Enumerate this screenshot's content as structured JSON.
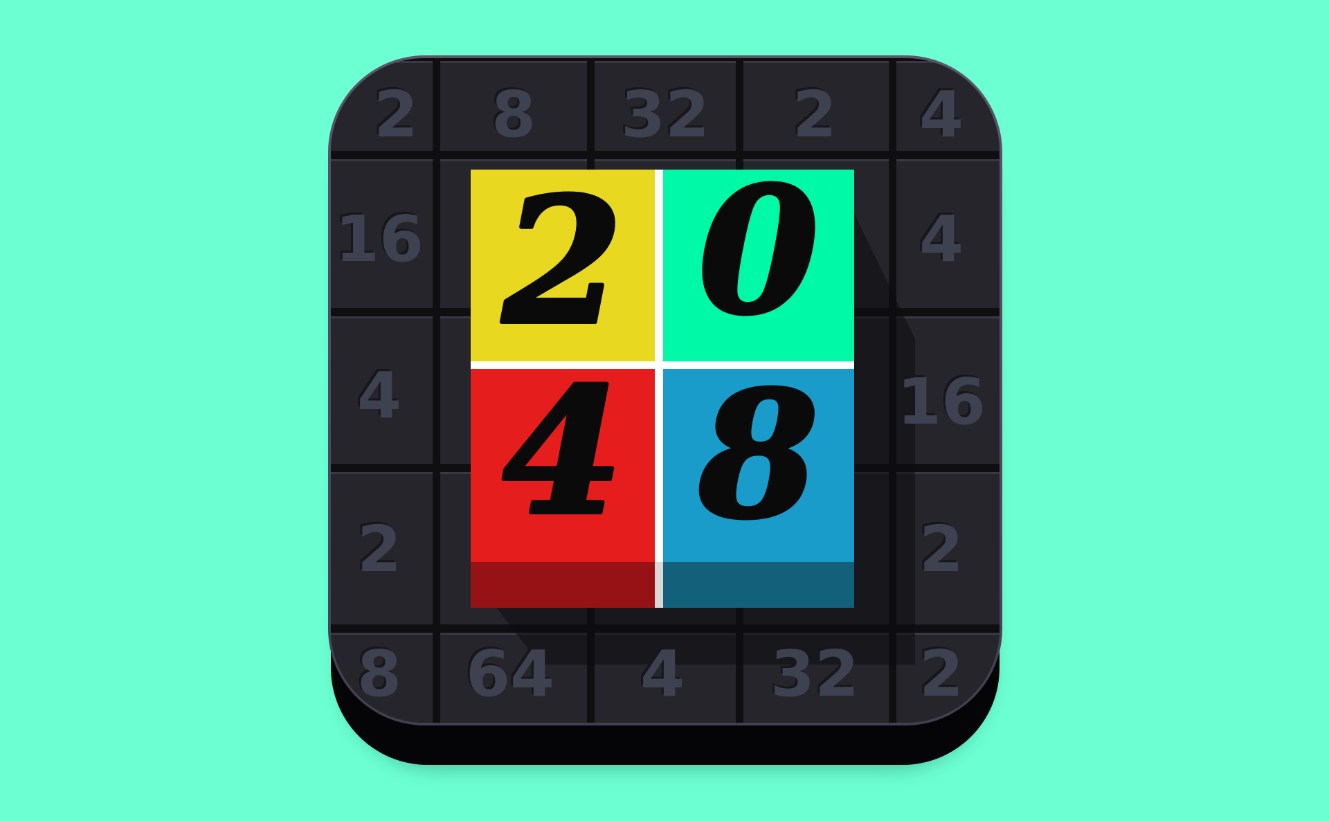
{
  "app": {
    "name": "2048"
  },
  "colors": {
    "background": "#6cffd2",
    "board_face": "#26252b",
    "board_rim": "#504c5f",
    "board_base": "#050507",
    "grid_line": "#0f0f12",
    "board_number": "#3e4150",
    "tile_yellow": "#e8d81f",
    "tile_green": "#00f9a7",
    "tile_red": "#e61d1d",
    "tile_blue": "#1a9ccb",
    "tile_red_shade": "#961214",
    "tile_blue_shade": "#126079",
    "divider": "#ffffff"
  },
  "board": {
    "top_row": [
      "2",
      "8",
      "32",
      "2",
      "4"
    ],
    "left_column": [
      "16",
      "4",
      "2"
    ],
    "right_column": [
      "4",
      "16",
      "2"
    ],
    "bottom_row": [
      "8",
      "64",
      "4",
      "32",
      "2"
    ]
  },
  "logo_tiles": [
    {
      "digit": "2",
      "color": "yellow"
    },
    {
      "digit": "0",
      "color": "green"
    },
    {
      "digit": "4",
      "color": "red"
    },
    {
      "digit": "8",
      "color": "blue"
    }
  ]
}
